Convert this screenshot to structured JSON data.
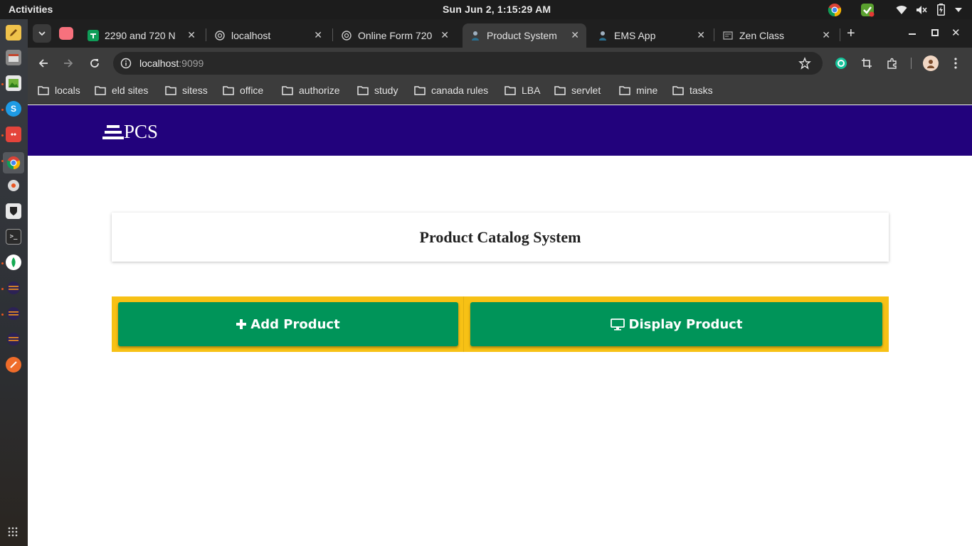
{
  "system": {
    "activities": "Activities",
    "clock": "Sun Jun  2,  1:15:29 AM"
  },
  "browser": {
    "tabs": [
      {
        "title": "2290 and 720 N",
        "favicon": "sheets-icon",
        "active": false
      },
      {
        "title": "localhost",
        "favicon": "globe-icon",
        "active": false
      },
      {
        "title": "Online Form 720",
        "favicon": "globe-icon",
        "active": false
      },
      {
        "title": "Product System",
        "favicon": "person-icon",
        "active": true
      },
      {
        "title": "EMS App",
        "favicon": "person-icon",
        "active": false
      },
      {
        "title": "Zen Class",
        "favicon": "page-icon",
        "active": false
      }
    ],
    "url": {
      "host": "localhost",
      "port": ":9099"
    },
    "bookmarks": [
      "locals",
      "eld sites",
      "sitess",
      "office",
      "authorize",
      "study",
      "canada rules",
      "LBA",
      "servlet",
      "mine",
      "tasks"
    ]
  },
  "app": {
    "brand": "PCS",
    "title": "Product Catalog System",
    "buttons": {
      "add": "Add Product",
      "display": "Display Product"
    },
    "colors": {
      "navbar": "#22027c",
      "button": "#009459",
      "button_group_bg": "#f7c115"
    }
  }
}
